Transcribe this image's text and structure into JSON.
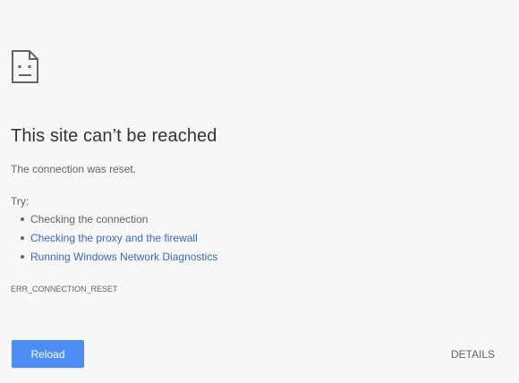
{
  "error_page": {
    "icon": "sad-page-icon",
    "title": "This site can’t be reached",
    "subtitle": "The connection was reset.",
    "try_label": "Try:",
    "suggestions": [
      {
        "text": "Checking the connection",
        "is_link": false
      },
      {
        "text": "Checking the proxy and the firewall",
        "is_link": true
      },
      {
        "text": "Running Windows Network Diagnostics",
        "is_link": true
      }
    ],
    "error_code": "ERR_CONNECTION_RESET"
  },
  "actions": {
    "reload_label": "Reload",
    "details_label": "DETAILS"
  },
  "colors": {
    "background": "#f7f7f7",
    "title_text": "#333333",
    "body_text": "#646464",
    "link": "#3a68c8",
    "reload_button_bg": "#4c8ef3",
    "reload_button_text": "#ffffff"
  }
}
